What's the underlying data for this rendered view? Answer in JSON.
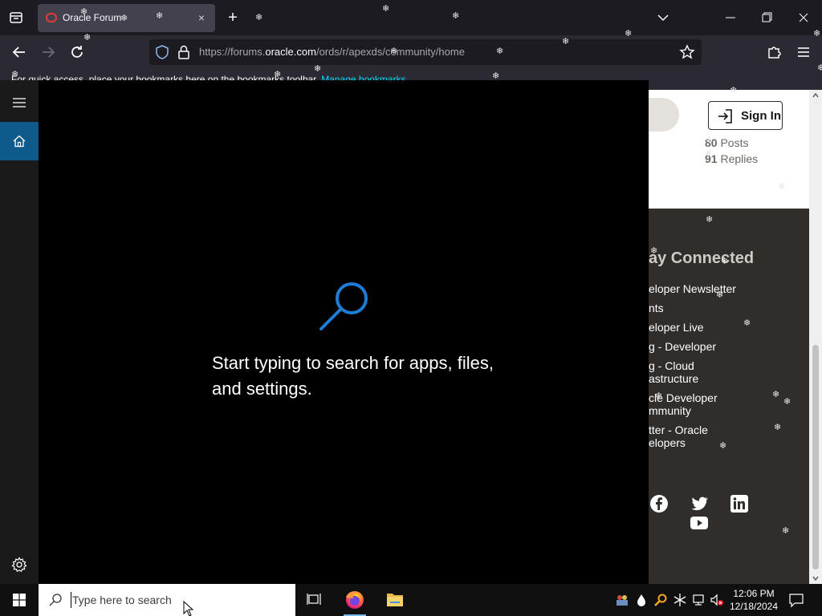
{
  "browser": {
    "tab_title": "Oracle Forum",
    "tab_close": "×",
    "new_tab": "+",
    "url_prefix": "https://forums.",
    "url_domain": "oracle.com",
    "url_path": "/ords/r/apexds/community/home",
    "bookmarks_text": "For quick access, place your bookmarks here on the bookmarks toolbar.",
    "bookmarks_link": "Manage bookmarks…"
  },
  "webpage": {
    "signin_label": "Sign In",
    "stats": [
      {
        "count": "80",
        "label": "Posts"
      },
      {
        "count": "91",
        "label": "Replies"
      }
    ],
    "stay_connected_title": "ay Connected",
    "stay_links": [
      "eloper Newsletter",
      "nts",
      "eloper Live",
      "g - Developer",
      "g - Cloud astructure",
      "cle Developer mmunity",
      "tter - Oracle elopers"
    ],
    "social_icons": [
      "facebook-icon",
      "twitter-icon",
      "linkedin-icon",
      "youtube-icon"
    ]
  },
  "start_menu": {
    "hint": "Start typing to search for apps, files, and settings.",
    "rail_items": [
      "hamburger-menu-icon",
      "home-icon",
      "settings-gear-icon"
    ]
  },
  "taskbar": {
    "search_placeholder": "Type here to search",
    "apps": [
      "task-view-icon",
      "firefox-icon",
      "file-explorer-icon"
    ],
    "clock_time": "12:06 PM",
    "clock_date": "12/18/2024"
  },
  "colors": {
    "accent": "#0e5a8a",
    "search_icon_blue": "#1d7dd6",
    "page_bg": "#312d2a",
    "chrome_bg": "#1c1b22"
  }
}
